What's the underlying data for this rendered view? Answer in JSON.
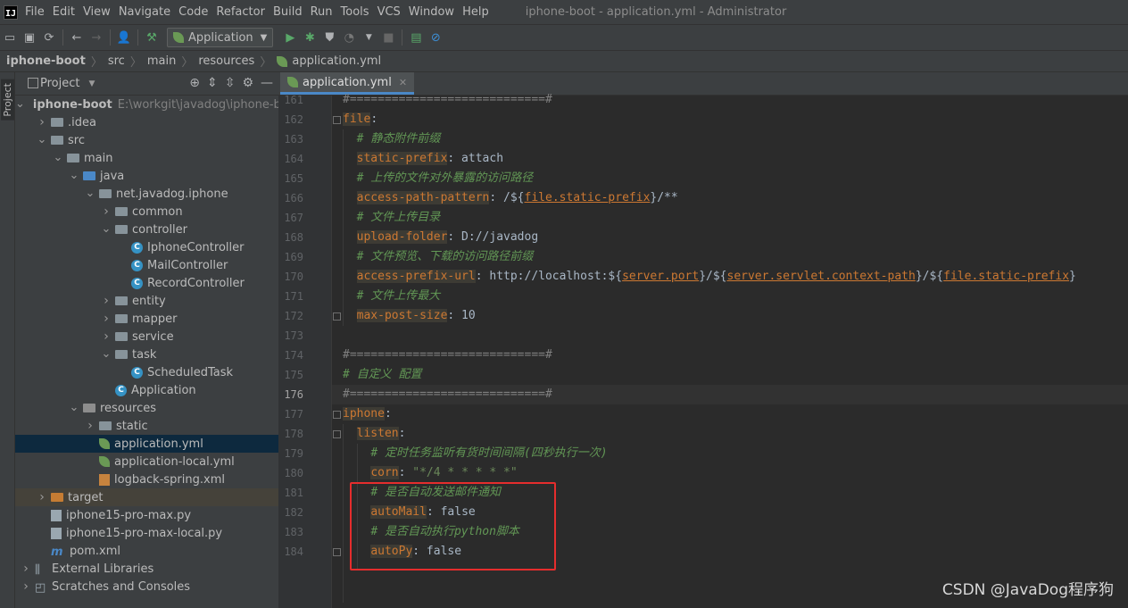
{
  "menu": {
    "logo": "IJ",
    "items": [
      "File",
      "Edit",
      "View",
      "Navigate",
      "Code",
      "Refactor",
      "Build",
      "Run",
      "Tools",
      "VCS",
      "Window",
      "Help"
    ],
    "window_title": "iphone-boot - application.yml - Administrator"
  },
  "toolbar": {
    "run_config": "Application"
  },
  "breadcrumb": [
    "iphone-boot",
    "src",
    "main",
    "resources",
    "application.yml"
  ],
  "stripe": {
    "project_label": "Project"
  },
  "project_panel": {
    "title": "Project",
    "tree": [
      {
        "label": "iphone-boot",
        "extra": "E:\\workgit\\javadog\\iphone-b",
        "type": "module",
        "indent": 0,
        "arrow": "down"
      },
      {
        "label": ".idea",
        "type": "folder",
        "indent": 1,
        "arrow": "right"
      },
      {
        "label": "src",
        "type": "folder",
        "indent": 1,
        "arrow": "down"
      },
      {
        "label": "main",
        "type": "folder",
        "indent": 2,
        "arrow": "down"
      },
      {
        "label": "java",
        "type": "folder-blue",
        "indent": 3,
        "arrow": "down"
      },
      {
        "label": "net.javadog.iphone",
        "type": "package",
        "indent": 4,
        "arrow": "down"
      },
      {
        "label": "common",
        "type": "package",
        "indent": 5,
        "arrow": "right"
      },
      {
        "label": "controller",
        "type": "package",
        "indent": 5,
        "arrow": "down"
      },
      {
        "label": "IphoneController",
        "type": "class",
        "indent": 6,
        "arrow": ""
      },
      {
        "label": "MailController",
        "type": "class",
        "indent": 6,
        "arrow": ""
      },
      {
        "label": "RecordController",
        "type": "class",
        "indent": 6,
        "arrow": ""
      },
      {
        "label": "entity",
        "type": "package",
        "indent": 5,
        "arrow": "right"
      },
      {
        "label": "mapper",
        "type": "package",
        "indent": 5,
        "arrow": "right"
      },
      {
        "label": "service",
        "type": "package",
        "indent": 5,
        "arrow": "right"
      },
      {
        "label": "task",
        "type": "package",
        "indent": 5,
        "arrow": "down"
      },
      {
        "label": "ScheduledTask",
        "type": "class",
        "indent": 6,
        "arrow": ""
      },
      {
        "label": "Application",
        "type": "spring-class",
        "indent": 5,
        "arrow": ""
      },
      {
        "label": "resources",
        "type": "folder-res",
        "indent": 3,
        "arrow": "down"
      },
      {
        "label": "static",
        "type": "folder",
        "indent": 4,
        "arrow": "right"
      },
      {
        "label": "application.yml",
        "type": "yml",
        "indent": 4,
        "arrow": "",
        "selected": true
      },
      {
        "label": "application-local.yml",
        "type": "yml",
        "indent": 4,
        "arrow": ""
      },
      {
        "label": "logback-spring.xml",
        "type": "xml",
        "indent": 4,
        "arrow": ""
      },
      {
        "label": "target",
        "type": "folder-orange",
        "indent": 1,
        "arrow": "right",
        "target": true
      },
      {
        "label": "iphone15-pro-max.py",
        "type": "file",
        "indent": 1,
        "arrow": ""
      },
      {
        "label": "iphone15-pro-max-local.py",
        "type": "file",
        "indent": 1,
        "arrow": ""
      },
      {
        "label": "pom.xml",
        "type": "maven",
        "indent": 1,
        "arrow": ""
      },
      {
        "label": "External Libraries",
        "type": "libs",
        "indent": 0,
        "arrow": "right"
      },
      {
        "label": "Scratches and Consoles",
        "type": "scratch",
        "indent": 0,
        "arrow": "right"
      }
    ]
  },
  "editor": {
    "tab": "application.yml",
    "current_line": 176,
    "lines": [
      {
        "n": 161,
        "parts": [
          [
            "gray",
            "#============================#"
          ]
        ]
      },
      {
        "n": 162,
        "parts": [
          [
            "key",
            "file"
          ],
          [
            "val",
            ":"
          ]
        ]
      },
      {
        "n": 163,
        "parts": [
          [
            "sp",
            "  "
          ],
          [
            "com",
            "# 静态附件前缀"
          ]
        ]
      },
      {
        "n": 164,
        "parts": [
          [
            "sp",
            "  "
          ],
          [
            "key",
            "static-prefix"
          ],
          [
            "val",
            ": attach"
          ]
        ]
      },
      {
        "n": 165,
        "parts": [
          [
            "sp",
            "  "
          ],
          [
            "com",
            "# 上传的文件对外暴露的访问路径"
          ]
        ]
      },
      {
        "n": 166,
        "parts": [
          [
            "sp",
            "  "
          ],
          [
            "key",
            "access-path-pattern"
          ],
          [
            "val",
            ": /${"
          ],
          [
            "ref",
            "file.static-prefix"
          ],
          [
            "val",
            "}/**"
          ]
        ]
      },
      {
        "n": 167,
        "parts": [
          [
            "sp",
            "  "
          ],
          [
            "com",
            "# 文件上传目录"
          ]
        ]
      },
      {
        "n": 168,
        "parts": [
          [
            "sp",
            "  "
          ],
          [
            "key",
            "upload-folder"
          ],
          [
            "val",
            ": D://javadog"
          ]
        ]
      },
      {
        "n": 169,
        "parts": [
          [
            "sp",
            "  "
          ],
          [
            "com",
            "# 文件预览、下载的访问路径前缀"
          ]
        ]
      },
      {
        "n": 170,
        "parts": [
          [
            "sp",
            "  "
          ],
          [
            "key",
            "access-prefix-url"
          ],
          [
            "val",
            ": http://localhost:${"
          ],
          [
            "ref",
            "server.port"
          ],
          [
            "val",
            "}/${"
          ],
          [
            "ref",
            "server.servlet.context-path"
          ],
          [
            "val",
            "}/${"
          ],
          [
            "ref",
            "file.static-prefix"
          ],
          [
            "val",
            "}"
          ]
        ]
      },
      {
        "n": 171,
        "parts": [
          [
            "sp",
            "  "
          ],
          [
            "com",
            "# 文件上传最大"
          ]
        ]
      },
      {
        "n": 172,
        "parts": [
          [
            "sp",
            "  "
          ],
          [
            "key",
            "max-post-size"
          ],
          [
            "val",
            ": 10"
          ]
        ]
      },
      {
        "n": 173,
        "parts": []
      },
      {
        "n": 174,
        "parts": [
          [
            "gray",
            "#============================#"
          ]
        ]
      },
      {
        "n": 175,
        "parts": [
          [
            "com",
            "# 自定义 配置"
          ]
        ]
      },
      {
        "n": 176,
        "parts": [
          [
            "gray",
            "#============================#"
          ]
        ]
      },
      {
        "n": 177,
        "parts": [
          [
            "key",
            "iphone"
          ],
          [
            "val",
            ":"
          ]
        ]
      },
      {
        "n": 178,
        "parts": [
          [
            "sp",
            "  "
          ],
          [
            "key",
            "listen"
          ],
          [
            "val",
            ":"
          ]
        ]
      },
      {
        "n": 179,
        "parts": [
          [
            "sp",
            "    "
          ],
          [
            "com",
            "# 定时任务监听有货时间间隔(四秒执行一次)"
          ]
        ]
      },
      {
        "n": 180,
        "parts": [
          [
            "sp",
            "    "
          ],
          [
            "key",
            "corn"
          ],
          [
            "val",
            ": "
          ],
          [
            "str",
            "\"*/4 * * * * *\""
          ]
        ]
      },
      {
        "n": 181,
        "parts": [
          [
            "sp",
            "    "
          ],
          [
            "com",
            "# 是否自动发送邮件通知"
          ]
        ]
      },
      {
        "n": 182,
        "parts": [
          [
            "sp",
            "    "
          ],
          [
            "key",
            "autoMail"
          ],
          [
            "val",
            ": false"
          ]
        ]
      },
      {
        "n": 183,
        "parts": [
          [
            "sp",
            "    "
          ],
          [
            "com",
            "# 是否自动执行python脚本"
          ]
        ]
      },
      {
        "n": 184,
        "parts": [
          [
            "sp",
            "    "
          ],
          [
            "key",
            "autoPy"
          ],
          [
            "val",
            ": false"
          ]
        ]
      }
    ]
  },
  "watermark": "CSDN @JavaDog程序狗",
  "colors": {
    "highlight_box": "#e52d2d",
    "key": "#cc7832",
    "comment": "#629755",
    "selection": "#0d293e"
  }
}
